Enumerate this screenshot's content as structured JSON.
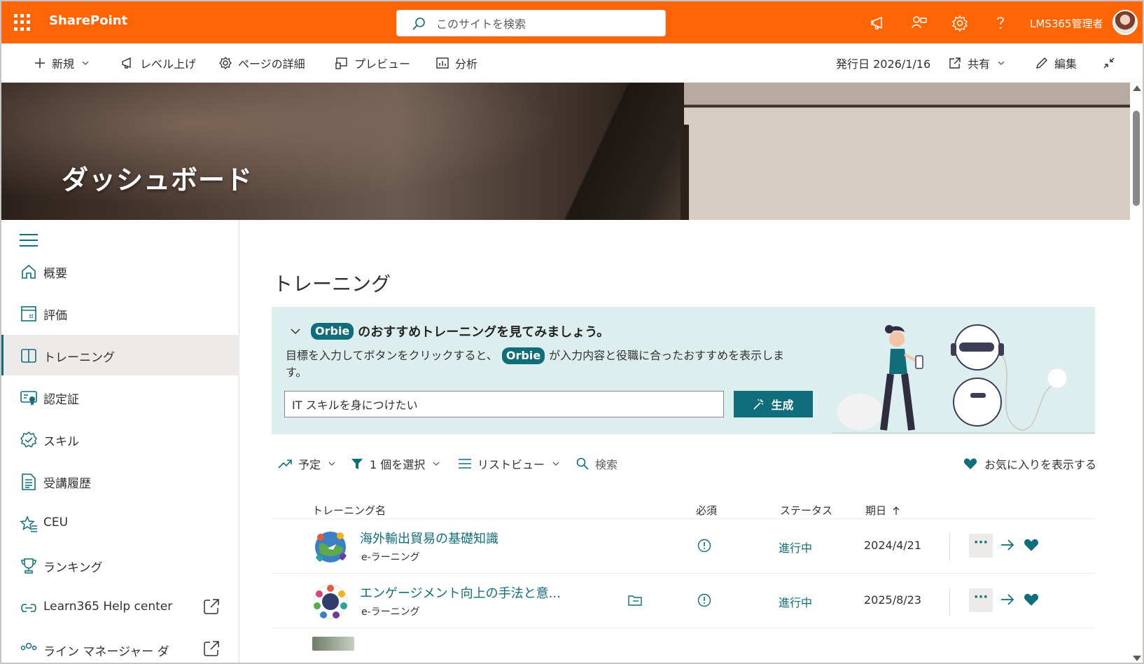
{
  "suitebar": {
    "app_name": "SharePoint",
    "search_placeholder": "このサイトを検索",
    "user_name": "LMS365管理者"
  },
  "commandbar": {
    "new_label": "新規",
    "promote_label": "レベル上げ",
    "page_details_label": "ページの詳細",
    "preview_label": "プレビュー",
    "analytics_label": "分析",
    "published_label": "発行日 2026/1/16",
    "share_label": "共有",
    "edit_label": "編集"
  },
  "hero": {
    "title": "ダッシュボード"
  },
  "leftnav": {
    "items": [
      {
        "label": "概要",
        "icon": "home-icon"
      },
      {
        "label": "評価",
        "icon": "assessment-icon"
      },
      {
        "label": "トレーニング",
        "icon": "book-icon",
        "active": true
      },
      {
        "label": "認定証",
        "icon": "certificate-icon"
      },
      {
        "label": "スキル",
        "icon": "skill-badge-icon"
      },
      {
        "label": "受講履歴",
        "icon": "transcript-icon"
      },
      {
        "label": "CEU",
        "icon": "star-list-icon"
      },
      {
        "label": "ランキング",
        "icon": "trophy-icon"
      },
      {
        "label": "Learn365 Help center",
        "icon": "link-icon",
        "external": true
      },
      {
        "label": "ライン マネージャー ダ",
        "icon": "people-icon",
        "external": true
      }
    ]
  },
  "main": {
    "section_title": "トレーニング",
    "orbie": {
      "pill": "Orbie",
      "heading": "のおすすめトレーニングを見てみましょう。",
      "desc_before": "目標を入力してボタンをクリックすると、",
      "desc_after": "が入力内容と役職に合ったおすすめを表示します。",
      "input_value": "IT スキルを身につけたい",
      "generate_label": "生成"
    },
    "filters": {
      "scheduled_label": "予定",
      "selected_label": "1 個を選択",
      "view_label": "リストビュー",
      "search_placeholder": "検索",
      "favorites_label": "お気に入りを表示する"
    },
    "table": {
      "headers": {
        "name": "トレーニング名",
        "required": "必須",
        "status": "ステータス",
        "due": "期日"
      },
      "rows": [
        {
          "title": "海外輸出貿易の基礎知識",
          "type": "e-ラーニング",
          "status": "進行中",
          "due": "2024/4/21"
        },
        {
          "title": "エンゲージメント向上の手法と意...",
          "type": "e-ラーニング",
          "status": "進行中",
          "due": "2025/8/23"
        }
      ]
    }
  },
  "colors": {
    "suitebar": "#ff6505",
    "accent": "#0f6e7a",
    "panel": "#ddeeee"
  }
}
